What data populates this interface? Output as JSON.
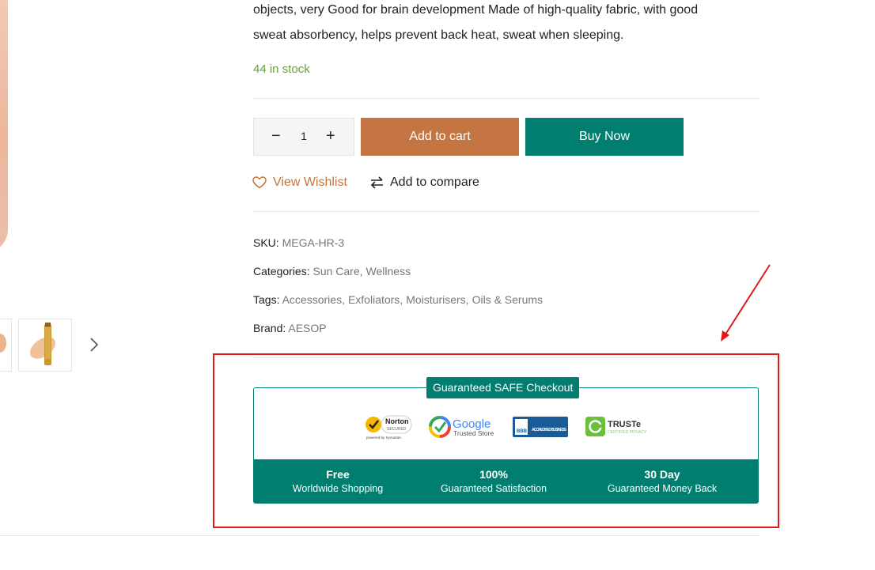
{
  "description": {
    "line1": "objects, very Good for brain development Made of high-quality fabric, with good",
    "line2": "sweat absorbency, helps prevent back heat, sweat when sleeping."
  },
  "stock": "44 in stock",
  "quantity": {
    "minus": "−",
    "value": "1",
    "plus": "+"
  },
  "buttons": {
    "add_to_cart": "Add to cart",
    "buy_now": "Buy Now"
  },
  "actions": {
    "wishlist": "View Wishlist",
    "compare": "Add to compare"
  },
  "meta": {
    "sku_label": "SKU:",
    "sku_value": "MEGA-HR-3",
    "categories_label": "Categories:",
    "categories": [
      "Sun Care",
      "Wellness"
    ],
    "tags_label": "Tags:",
    "tags": [
      "Accessories",
      "Exfoliators",
      "Moisturisers",
      "Oils & Serums"
    ],
    "brand_label": "Brand:",
    "brand_value": "AESOP"
  },
  "checkout": {
    "title": "Guaranteed SAFE Checkout",
    "logos": [
      {
        "icon": "norton-secured-icon",
        "text": "Norton",
        "sub": "SECURED",
        "foot": "powered by Symantec"
      },
      {
        "icon": "google-trusted-store-icon",
        "text": "Google",
        "sub": "Trusted Store"
      },
      {
        "icon": "bbb-accredited-icon",
        "text": "BBB",
        "sub": "ACCREDITED BUSINESS"
      },
      {
        "icon": "truste-icon",
        "text": "TRUSTe",
        "sub": "CERTIFIED PRIVACY"
      }
    ],
    "features": [
      {
        "bold": "Free",
        "sub": "Worldwide Shopping"
      },
      {
        "bold": "100%",
        "sub": "Guaranteed Satisfaction"
      },
      {
        "bold": "30 Day",
        "sub": "Guaranteed Money Back"
      }
    ]
  },
  "colors": {
    "accent": "#c47541",
    "teal": "#007f70",
    "stock": "#6a9e3f",
    "annotation": "#e01919"
  }
}
